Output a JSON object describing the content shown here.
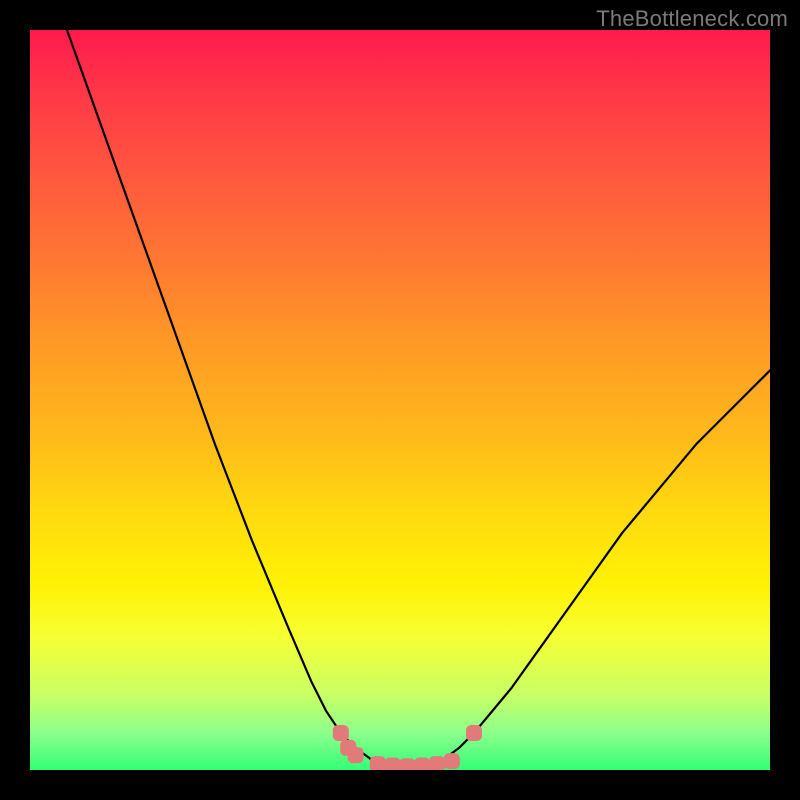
{
  "watermark": "TheBottleneck.com",
  "colors": {
    "background": "#000000",
    "curve": "#000000",
    "marker": "#e27a7a",
    "gradient_top": "#ff1a4d",
    "gradient_bottom": "#33ff77"
  },
  "chart_data": {
    "type": "line",
    "title": "",
    "xlabel": "",
    "ylabel": "",
    "xlim": [
      0,
      100
    ],
    "ylim": [
      0,
      100
    ],
    "series": [
      {
        "name": "bottleneck-curve",
        "x": [
          5,
          10,
          15,
          20,
          25,
          30,
          35,
          38,
          40,
          42,
          44,
          46,
          48,
          50,
          52,
          54,
          56,
          58,
          60,
          65,
          70,
          75,
          80,
          85,
          90,
          95,
          100
        ],
        "y": [
          100,
          86,
          72,
          58,
          44,
          31,
          19,
          12,
          8,
          5,
          3,
          1.5,
          0.8,
          0.5,
          0.5,
          0.8,
          1.5,
          3,
          5,
          11,
          18,
          25,
          32,
          38,
          44,
          49,
          54
        ]
      }
    ],
    "markers": [
      {
        "x": 42,
        "y": 5
      },
      {
        "x": 43,
        "y": 3
      },
      {
        "x": 44,
        "y": 2
      },
      {
        "x": 47,
        "y": 0.8
      },
      {
        "x": 49,
        "y": 0.6
      },
      {
        "x": 51,
        "y": 0.5
      },
      {
        "x": 53,
        "y": 0.6
      },
      {
        "x": 55,
        "y": 0.8
      },
      {
        "x": 57,
        "y": 1.2
      },
      {
        "x": 60,
        "y": 5
      }
    ]
  }
}
